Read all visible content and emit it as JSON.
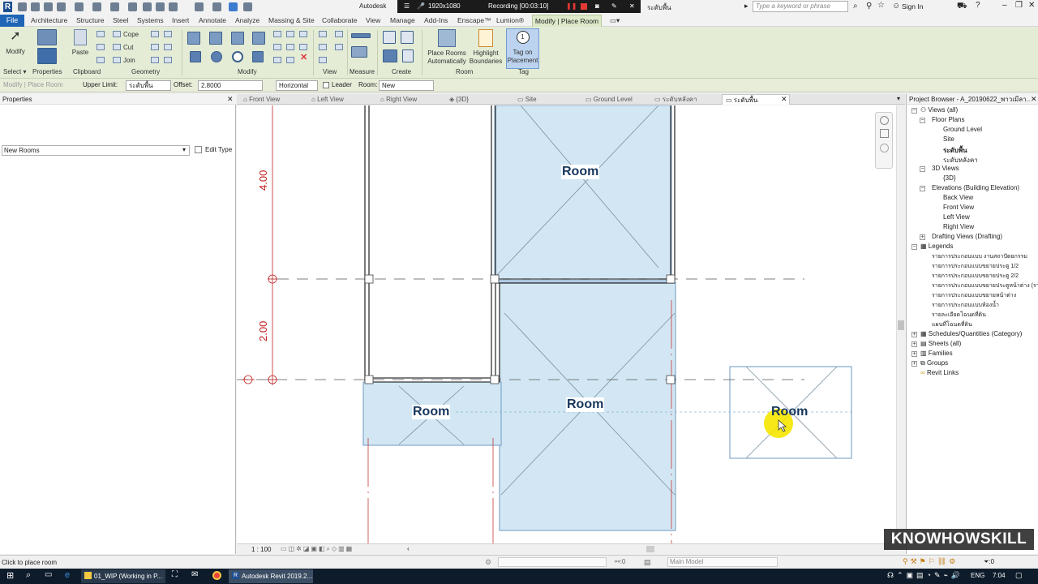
{
  "titlebar": {
    "app_name": "Autodesk",
    "recording_resolution": "1920x1080",
    "recording_label": "Recording [00:03:10]",
    "level_name": "ระดับพื้น",
    "search_placeholder": "Type a keyword or phrase",
    "sign_in": "Sign In"
  },
  "menu": {
    "file": "File",
    "items": [
      "Architecture",
      "Structure",
      "Steel",
      "Systems",
      "Insert",
      "Annotate",
      "Analyze",
      "Massing & Site",
      "Collaborate",
      "View",
      "Manage",
      "Add-Ins",
      "Enscape™",
      "Lumion®"
    ],
    "active": "Modify | Place Room"
  },
  "ribbon": {
    "modify": "Modify",
    "paste": "Paste",
    "cope": "Cope",
    "cut": "Cut",
    "join": "Join",
    "place_rooms": "Place Rooms Automatically",
    "highlight": "Highlight Boundaries",
    "tag": "Tag on Placement",
    "groups": [
      "Select ▾",
      "Properties",
      "Clipboard",
      "Geometry",
      "Modify",
      "View",
      "Measure",
      "Create",
      "Room",
      "Tag"
    ]
  },
  "options": {
    "context": "Modify | Place Room",
    "upper_limit_label": "Upper Limit:",
    "upper_limit_value": "ระดับพื้น",
    "offset_label": "Offset:",
    "offset_value": "2.8000",
    "orientation": "Horizontal",
    "leader": "Leader",
    "room_label": "Room:",
    "room_value": "New"
  },
  "properties": {
    "title": "Properties",
    "type": "New Rooms",
    "edit_type": "Edit Type"
  },
  "view_tabs": [
    "Front View",
    "Left View",
    "Right View",
    "{3D}",
    "Site",
    "Ground Level",
    "ระดับหลังคา",
    "ระดับพื้น"
  ],
  "canvas": {
    "dim_upper": "4.00",
    "dim_lower": "2.00",
    "room_label": "Room",
    "scale": "1 : 100"
  },
  "browser": {
    "title": "Project Browser - A_20190622_พาวเมีลา...",
    "views_all": "Views (all)",
    "floor_plans": "Floor Plans",
    "floor_items": [
      "Ground Level",
      "Site",
      "ระดับพื้น",
      "ระดับหลังคา"
    ],
    "views_3d": "3D Views",
    "views_3d_items": [
      "{3D}"
    ],
    "elevations": "Elevations (Building Elevation)",
    "elevation_items": [
      "Back View",
      "Front View",
      "Left View",
      "Right View"
    ],
    "drafting": "Drafting Views (Drafting)",
    "legends": "Legends",
    "legend_items": [
      "รายการประกอบแบบ งานสถาปัตยกรรม",
      "รายการประกอบแบบขยายประตู 1/2",
      "รายการประกอบแบบขยายประตู 2/2",
      "รายการประกอบแบบขยายประตูหน้าต่าง (รา",
      "รายการประกอบแบบขยายหน้าต่าง",
      "รายการประกอบแบบห้องน้ำ",
      "รายละเอียดโฉนดที่ดิน",
      "แผนที่โฉนดที่ดิน"
    ],
    "schedules": "Schedules/Quantities (Category)",
    "sheets": "Sheets (all)",
    "families": "Families",
    "groups": "Groups",
    "revit_links": "Revit Links"
  },
  "status": {
    "message": "Click to place room",
    "zero": ":0",
    "model": "Main Model",
    "filter": ":0"
  },
  "taskbar": {
    "explorer": "01_WIP (Working in P...",
    "revit": "Autodesk Revit 2019.2...",
    "lang": "ENG",
    "time": "7:04"
  },
  "watermark": "KNOWHOWSKILL",
  "colors": {
    "file_tab": "#1e65b5",
    "ribbon": "#e4ecd6",
    "room_fill": "#cfe6f2",
    "grid": "#c02020",
    "cursor": "#f5e600",
    "room_text": "#17365d"
  }
}
